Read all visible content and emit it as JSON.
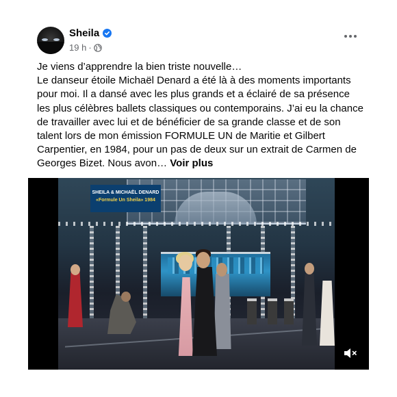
{
  "author": {
    "name": "Sheila",
    "verified": true,
    "avatar": "avatar-photo"
  },
  "meta": {
    "time": "19 h",
    "separator": "·",
    "audience_icon": "globe-icon"
  },
  "menu": {
    "icon": "more-horizontal-icon"
  },
  "post": {
    "line1": "Je viens d’apprendre la bien triste nouvelle…",
    "paragraph": "Le danseur étoile Michaël Denard a été là à des moments importants pour moi. Il a dansé avec les plus grands et a éclairé de sa présence les plus célèbres ballets classiques ou contemporains. J’ai eu la chance de travailler avec lui et de bénéficier de sa grande classe et de son talent lors de mon émission FORMULE UN de Maritie et Gilbert Carpentier, en 1984, pour un pas de deux sur un extrait de Carmen de Georges Bizet. Nous avon…",
    "see_more": "Voir plus"
  },
  "video": {
    "caption_line1": "SHEILA & MICHAËL DENARD",
    "caption_line2": "«Formule Un Sheila» 1984",
    "muted": true,
    "mute_icon": "speaker-muted-icon"
  },
  "colors": {
    "verified_badge": "#1877f2",
    "secondary_text": "#65676b",
    "caption_bg": "#0b3f6f",
    "caption_accent": "#f3d24a"
  }
}
